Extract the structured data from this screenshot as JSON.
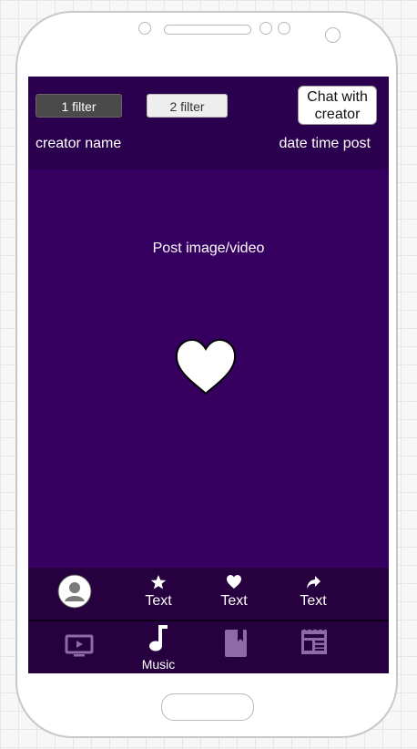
{
  "header": {
    "filter1_label": "1 filter",
    "filter2_label": "2 filter",
    "chat_label": "Chat with creator",
    "creator_name": "creator name",
    "date_time": "date time post"
  },
  "post": {
    "media_label": "Post image/video"
  },
  "actions": {
    "favorite_label": "Text",
    "like_label": "Text",
    "share_label": "Text"
  },
  "nav": {
    "music_label": "Music"
  },
  "colors": {
    "screen_bg": "#350060",
    "header_bg": "#2b004e",
    "bar_bg": "#27003f",
    "icon_inactive": "#8e6aa7"
  },
  "icons": [
    "avatar-icon",
    "star-icon",
    "heart-icon",
    "share-icon",
    "tv-icon",
    "music-note-icon",
    "book-icon",
    "newspaper-icon"
  ]
}
